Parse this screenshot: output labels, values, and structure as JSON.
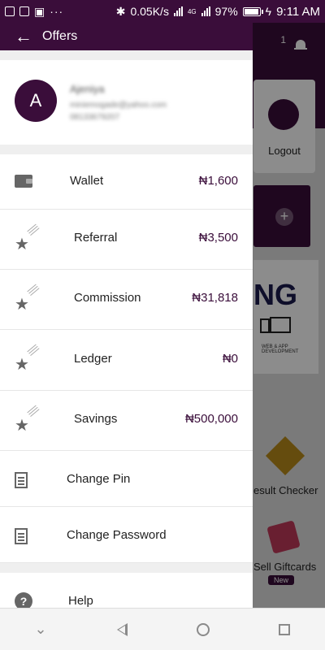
{
  "status_bar": {
    "speed": "0.05K/s",
    "network": "4G",
    "battery_percent": "97%",
    "time": "9:11 AM"
  },
  "drawer": {
    "title": "Offers",
    "profile": {
      "initial": "A",
      "name": "Ajeniya",
      "email": "miniemogade@yahoo.com",
      "phone": "08133679207"
    },
    "items": [
      {
        "label": "Wallet",
        "amount": "₦1,600",
        "icon": "wallet-icon"
      },
      {
        "label": "Referral",
        "amount": "₦3,500",
        "icon": "shooting-star-icon"
      },
      {
        "label": "Commission",
        "amount": "₦31,818",
        "icon": "shooting-star-icon"
      },
      {
        "label": "Ledger",
        "amount": "₦0",
        "icon": "shooting-star-icon"
      },
      {
        "label": "Savings",
        "amount": "₦500,000",
        "icon": "shooting-star-icon"
      },
      {
        "label": "Change Pin",
        "icon": "document-icon"
      },
      {
        "label": "Change Password",
        "icon": "document-icon"
      },
      {
        "label": "Help",
        "icon": "help-icon"
      }
    ]
  },
  "background": {
    "notification_count": "1",
    "logout_label": "Logout",
    "promo_text": "NG",
    "promo_small": "WEB & APP DEVELOPMENT",
    "result_checker_label": "esult Checker",
    "gift_cards_label": "Sell Giftcards",
    "new_badge": "New"
  },
  "colors": {
    "brand": "#3a0d3a"
  }
}
